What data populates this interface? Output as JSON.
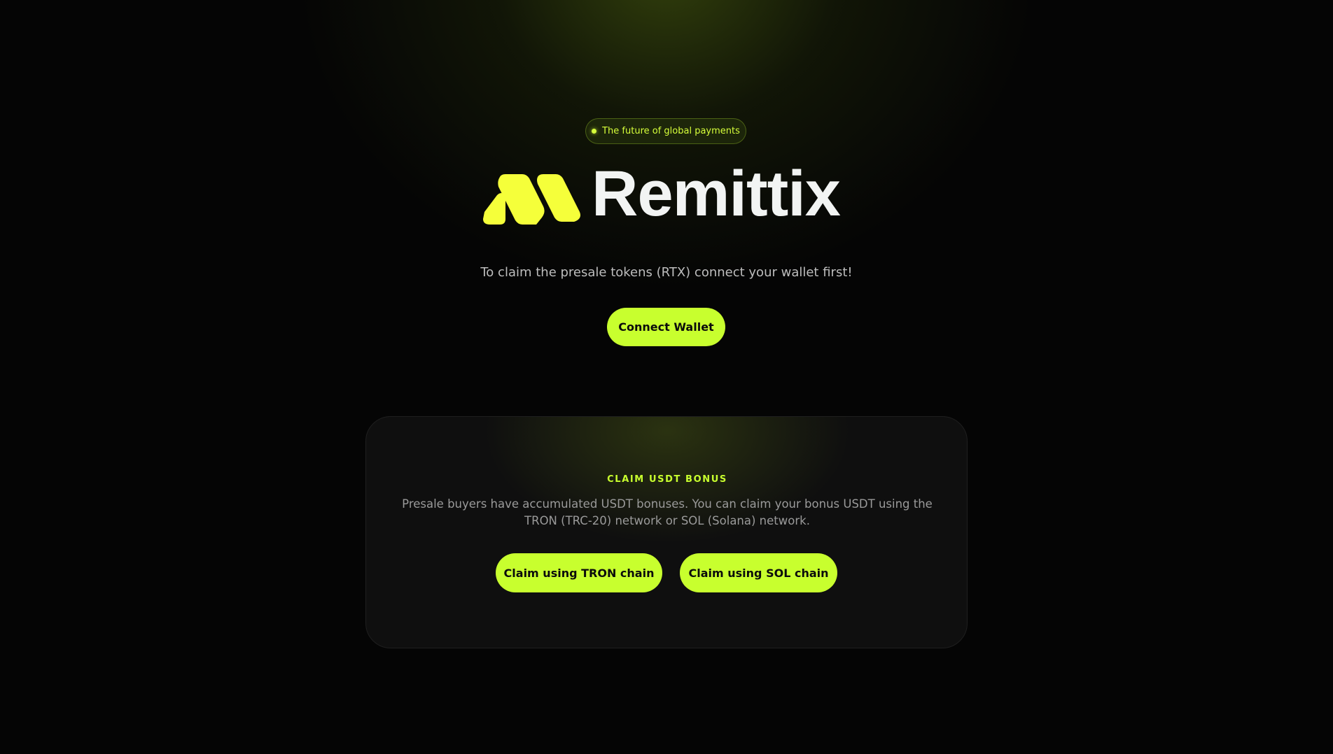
{
  "badge": {
    "text": "The future of global payments"
  },
  "brand": {
    "name": "Remittix",
    "logo_icon": "remittix-m-mark-icon",
    "accent_color": "#c8ff2e",
    "mark_color": "#f5ff3a"
  },
  "hero": {
    "subtitle": "To claim the presale tokens (RTX) connect your wallet first!",
    "connect_label": "Connect Wallet"
  },
  "bonus_card": {
    "title": "CLAIM USDT BONUS",
    "description": "Presale buyers have accumulated USDT bonuses. You can claim your bonus USDT using the TRON (TRC-20) network or SOL (Solana) network.",
    "tron_label": "Claim using TRON chain",
    "sol_label": "Claim using SOL chain"
  }
}
